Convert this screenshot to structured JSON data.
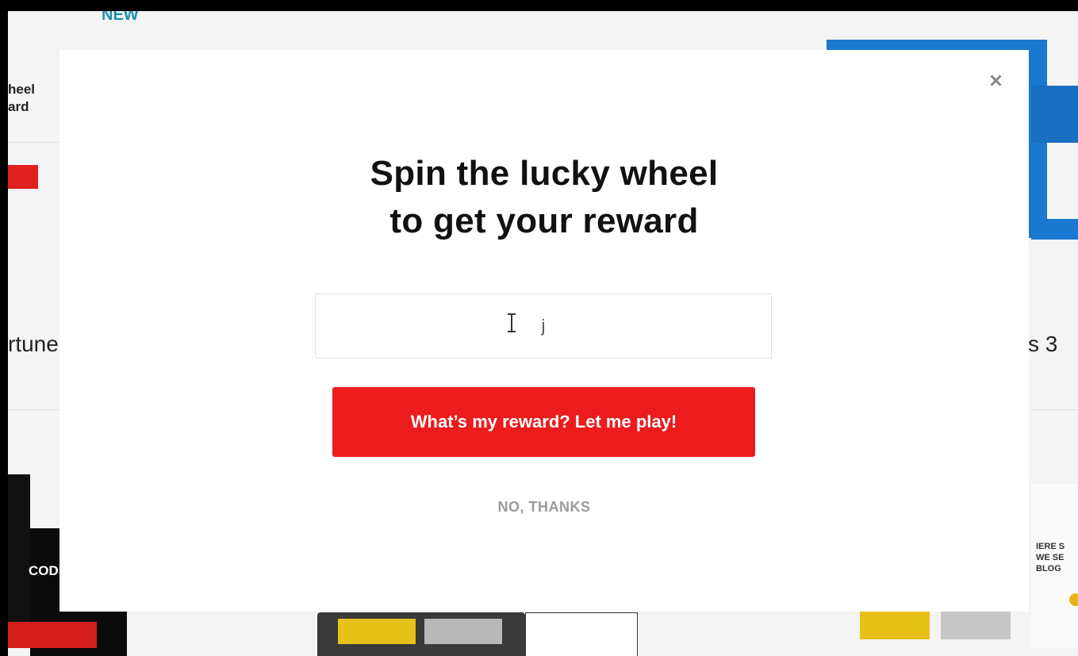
{
  "background": {
    "logo": "NEW",
    "left_title": "heel\nard",
    "left_big": "rtune",
    "right_big": "s 3",
    "left_badge": "CODE",
    "right_panel_text": "IERE S\nWE SE\nBLOG"
  },
  "modal": {
    "title_line1": "Spin the lucky wheel",
    "title_line2": "to get your reward",
    "email_value": "j",
    "email_placeholder": "",
    "submit_label": "What’s my reward? Let me play!",
    "decline_label": "NO, THANKS",
    "close_icon": "close-icon"
  },
  "colors": {
    "primary_button": "#ec1c1c",
    "title": "#111111",
    "decline_text": "#9a9a9a"
  }
}
